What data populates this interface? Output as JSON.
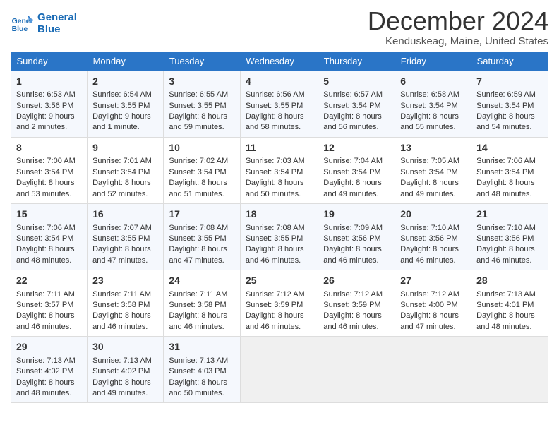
{
  "logo": {
    "line1": "General",
    "line2": "Blue"
  },
  "title": "December 2024",
  "subtitle": "Kenduskeag, Maine, United States",
  "days_of_week": [
    "Sunday",
    "Monday",
    "Tuesday",
    "Wednesday",
    "Thursday",
    "Friday",
    "Saturday"
  ],
  "weeks": [
    [
      {
        "day": "1",
        "sunrise": "Sunrise: 6:53 AM",
        "sunset": "Sunset: 3:56 PM",
        "daylight": "Daylight: 9 hours and 2 minutes."
      },
      {
        "day": "2",
        "sunrise": "Sunrise: 6:54 AM",
        "sunset": "Sunset: 3:55 PM",
        "daylight": "Daylight: 9 hours and 1 minute."
      },
      {
        "day": "3",
        "sunrise": "Sunrise: 6:55 AM",
        "sunset": "Sunset: 3:55 PM",
        "daylight": "Daylight: 8 hours and 59 minutes."
      },
      {
        "day": "4",
        "sunrise": "Sunrise: 6:56 AM",
        "sunset": "Sunset: 3:55 PM",
        "daylight": "Daylight: 8 hours and 58 minutes."
      },
      {
        "day": "5",
        "sunrise": "Sunrise: 6:57 AM",
        "sunset": "Sunset: 3:54 PM",
        "daylight": "Daylight: 8 hours and 56 minutes."
      },
      {
        "day": "6",
        "sunrise": "Sunrise: 6:58 AM",
        "sunset": "Sunset: 3:54 PM",
        "daylight": "Daylight: 8 hours and 55 minutes."
      },
      {
        "day": "7",
        "sunrise": "Sunrise: 6:59 AM",
        "sunset": "Sunset: 3:54 PM",
        "daylight": "Daylight: 8 hours and 54 minutes."
      }
    ],
    [
      {
        "day": "8",
        "sunrise": "Sunrise: 7:00 AM",
        "sunset": "Sunset: 3:54 PM",
        "daylight": "Daylight: 8 hours and 53 minutes."
      },
      {
        "day": "9",
        "sunrise": "Sunrise: 7:01 AM",
        "sunset": "Sunset: 3:54 PM",
        "daylight": "Daylight: 8 hours and 52 minutes."
      },
      {
        "day": "10",
        "sunrise": "Sunrise: 7:02 AM",
        "sunset": "Sunset: 3:54 PM",
        "daylight": "Daylight: 8 hours and 51 minutes."
      },
      {
        "day": "11",
        "sunrise": "Sunrise: 7:03 AM",
        "sunset": "Sunset: 3:54 PM",
        "daylight": "Daylight: 8 hours and 50 minutes."
      },
      {
        "day": "12",
        "sunrise": "Sunrise: 7:04 AM",
        "sunset": "Sunset: 3:54 PM",
        "daylight": "Daylight: 8 hours and 49 minutes."
      },
      {
        "day": "13",
        "sunrise": "Sunrise: 7:05 AM",
        "sunset": "Sunset: 3:54 PM",
        "daylight": "Daylight: 8 hours and 49 minutes."
      },
      {
        "day": "14",
        "sunrise": "Sunrise: 7:06 AM",
        "sunset": "Sunset: 3:54 PM",
        "daylight": "Daylight: 8 hours and 48 minutes."
      }
    ],
    [
      {
        "day": "15",
        "sunrise": "Sunrise: 7:06 AM",
        "sunset": "Sunset: 3:54 PM",
        "daylight": "Daylight: 8 hours and 48 minutes."
      },
      {
        "day": "16",
        "sunrise": "Sunrise: 7:07 AM",
        "sunset": "Sunset: 3:55 PM",
        "daylight": "Daylight: 8 hours and 47 minutes."
      },
      {
        "day": "17",
        "sunrise": "Sunrise: 7:08 AM",
        "sunset": "Sunset: 3:55 PM",
        "daylight": "Daylight: 8 hours and 47 minutes."
      },
      {
        "day": "18",
        "sunrise": "Sunrise: 7:08 AM",
        "sunset": "Sunset: 3:55 PM",
        "daylight": "Daylight: 8 hours and 46 minutes."
      },
      {
        "day": "19",
        "sunrise": "Sunrise: 7:09 AM",
        "sunset": "Sunset: 3:56 PM",
        "daylight": "Daylight: 8 hours and 46 minutes."
      },
      {
        "day": "20",
        "sunrise": "Sunrise: 7:10 AM",
        "sunset": "Sunset: 3:56 PM",
        "daylight": "Daylight: 8 hours and 46 minutes."
      },
      {
        "day": "21",
        "sunrise": "Sunrise: 7:10 AM",
        "sunset": "Sunset: 3:56 PM",
        "daylight": "Daylight: 8 hours and 46 minutes."
      }
    ],
    [
      {
        "day": "22",
        "sunrise": "Sunrise: 7:11 AM",
        "sunset": "Sunset: 3:57 PM",
        "daylight": "Daylight: 8 hours and 46 minutes."
      },
      {
        "day": "23",
        "sunrise": "Sunrise: 7:11 AM",
        "sunset": "Sunset: 3:58 PM",
        "daylight": "Daylight: 8 hours and 46 minutes."
      },
      {
        "day": "24",
        "sunrise": "Sunrise: 7:11 AM",
        "sunset": "Sunset: 3:58 PM",
        "daylight": "Daylight: 8 hours and 46 minutes."
      },
      {
        "day": "25",
        "sunrise": "Sunrise: 7:12 AM",
        "sunset": "Sunset: 3:59 PM",
        "daylight": "Daylight: 8 hours and 46 minutes."
      },
      {
        "day": "26",
        "sunrise": "Sunrise: 7:12 AM",
        "sunset": "Sunset: 3:59 PM",
        "daylight": "Daylight: 8 hours and 46 minutes."
      },
      {
        "day": "27",
        "sunrise": "Sunrise: 7:12 AM",
        "sunset": "Sunset: 4:00 PM",
        "daylight": "Daylight: 8 hours and 47 minutes."
      },
      {
        "day": "28",
        "sunrise": "Sunrise: 7:13 AM",
        "sunset": "Sunset: 4:01 PM",
        "daylight": "Daylight: 8 hours and 48 minutes."
      }
    ],
    [
      {
        "day": "29",
        "sunrise": "Sunrise: 7:13 AM",
        "sunset": "Sunset: 4:02 PM",
        "daylight": "Daylight: 8 hours and 48 minutes."
      },
      {
        "day": "30",
        "sunrise": "Sunrise: 7:13 AM",
        "sunset": "Sunset: 4:02 PM",
        "daylight": "Daylight: 8 hours and 49 minutes."
      },
      {
        "day": "31",
        "sunrise": "Sunrise: 7:13 AM",
        "sunset": "Sunset: 4:03 PM",
        "daylight": "Daylight: 8 hours and 50 minutes."
      },
      null,
      null,
      null,
      null
    ]
  ]
}
